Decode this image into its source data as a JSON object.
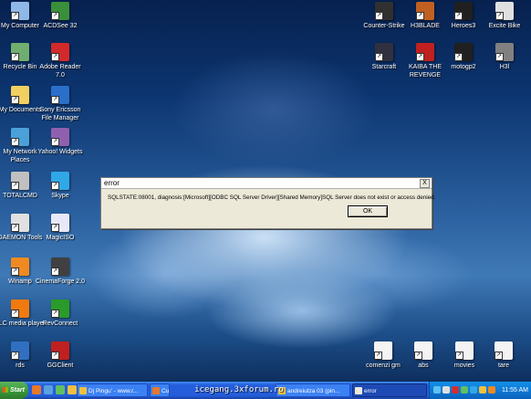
{
  "desktop": {
    "left_icons": [
      {
        "label": "My Computer",
        "color": "#8fb8e8"
      },
      {
        "label": "ACDSee 32",
        "color": "#3a8f3a"
      },
      {
        "label": "Recycle Bin",
        "color": "#6fae6f"
      },
      {
        "label": "Adobe Reader 7.0",
        "color": "#d22a2a"
      },
      {
        "label": "My Documents",
        "color": "#f0d060"
      },
      {
        "label": "Sony Ericsson File Manager",
        "color": "#2a6fc9"
      },
      {
        "label": "My Network Places",
        "color": "#4aa0d8"
      },
      {
        "label": "Yahoo! Widgets",
        "color": "#9060b0"
      },
      {
        "label": "TOTALCMD",
        "color": "#c0c0c0"
      },
      {
        "label": "Skype",
        "color": "#30a8e8"
      },
      {
        "label": "DAEMON Tools",
        "color": "#e0e0e0"
      },
      {
        "label": "MagicISO",
        "color": "#e8e8f8"
      },
      {
        "label": "Winamp",
        "color": "#f08a20"
      },
      {
        "label": "CinemaForge 2.0",
        "color": "#404040"
      },
      {
        "label": "VLC media player",
        "color": "#f07a10"
      },
      {
        "label": "RevConnect",
        "color": "#2a9a2a"
      },
      {
        "label": "rds",
        "color": "#3070c0"
      },
      {
        "label": "GGClient",
        "color": "#c02020"
      }
    ],
    "right_icons": [
      {
        "label": "Counter-Strike",
        "color": "#303030"
      },
      {
        "label": "H3BLADE",
        "color": "#c06020"
      },
      {
        "label": "Heroes3",
        "color": "#202020"
      },
      {
        "label": "Excite Bike",
        "color": "#e0e0e0"
      },
      {
        "label": "Starcraft",
        "color": "#303040"
      },
      {
        "label": "KAIBA THE REVENGE",
        "color": "#c02020"
      },
      {
        "label": "motogp2",
        "color": "#202020"
      },
      {
        "label": "H3l",
        "color": "#808080"
      }
    ],
    "bottom_right_icons": [
      {
        "label": "comenzi gm",
        "color": "#f4f4f4"
      },
      {
        "label": "abs",
        "color": "#f4f4f4"
      },
      {
        "label": "movies",
        "color": "#f4f4f4"
      },
      {
        "label": "tare",
        "color": "#f4f4f4"
      }
    ]
  },
  "dialog": {
    "title": "error",
    "close_label": "X",
    "message": "SQLSTATE:08001, diagnosis:[Microsoft][ODBC SQL Server Driver][Shared Memory]SQL Server does not exist or access denied.",
    "ok_label": "OK"
  },
  "taskbar": {
    "start_label": "Start",
    "quick_launch": [
      {
        "icon": "firefox-icon",
        "color": "#e8782a"
      },
      {
        "icon": "desktop-icon",
        "color": "#5aa0e0"
      },
      {
        "icon": "messenger-icon",
        "color": "#60c060"
      },
      {
        "icon": "media-icon",
        "color": "#f0c040"
      }
    ],
    "tasks": [
      {
        "label": "Dj Pingu' - www.r...",
        "color": "#f0c040",
        "active": false
      },
      {
        "label": "Cu",
        "color": "#e8782a",
        "active": false
      },
      {
        "label": "andreiutza 03 (pin...",
        "color": "#f0c040",
        "active": false
      },
      {
        "label": "error",
        "color": "#ece9d8",
        "active": true
      }
    ],
    "overlay_text": "icegang.3xforum.ro",
    "tray_icons": [
      {
        "icon": "network-icon",
        "color": "#60c0f0"
      },
      {
        "icon": "volume-icon",
        "color": "#e0e0e0"
      },
      {
        "icon": "antivirus-icon",
        "color": "#d03030"
      },
      {
        "icon": "messenger-tray-icon",
        "color": "#60c060"
      },
      {
        "icon": "skype-tray-icon",
        "color": "#30a8e8"
      },
      {
        "icon": "shield-tray-icon",
        "color": "#f0c040"
      },
      {
        "icon": "update-tray-icon",
        "color": "#f08a20"
      }
    ],
    "clock": "11:55 AM"
  }
}
